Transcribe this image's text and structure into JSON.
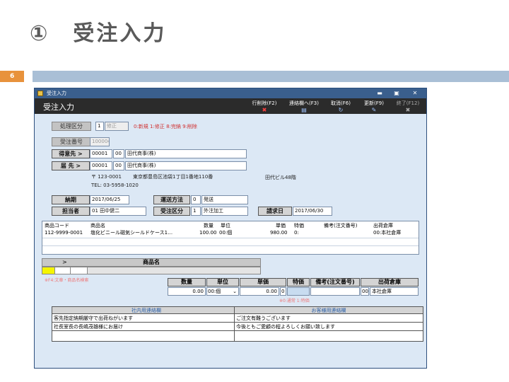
{
  "slide": {
    "title": "①　受注入力",
    "page_number": "6"
  },
  "window": {
    "title": "受注入力",
    "form_title": "受注入力",
    "buttons": {
      "min": "▬",
      "max": "▣",
      "close": "✕"
    }
  },
  "toolbar": [
    {
      "label": "行削除(F2)",
      "icon": "✖",
      "icon_name": "delete-row-icon"
    },
    {
      "label": "連絡欄へ(F3)",
      "icon": "▤",
      "icon_name": "memo-icon"
    },
    {
      "label": "取消(F6)",
      "icon": "↻",
      "icon_name": "undo-icon"
    },
    {
      "label": "更新(F9)",
      "icon": "✎",
      "icon_name": "save-icon"
    },
    {
      "label": "終了(F12)",
      "icon": "✖",
      "icon_name": "exit-icon"
    }
  ],
  "form": {
    "process_label": "処理区分",
    "process_code": "1",
    "process_name": "修正",
    "process_hint": "0:新規 1:修正 8:完納 9:削除",
    "order_no_label": "受注番号",
    "order_no": "100004",
    "customer_label": "得意先 >",
    "customer_code": "00001",
    "customer_sub": "00",
    "customer_name": "田代商事(株)",
    "ship_label": "届 先 >",
    "ship_code": "00001",
    "ship_sub": "00",
    "ship_name": "田代商事(株)",
    "postal": "〒 123-0001",
    "address": "東京都豊島区池袋1丁目1番地110番",
    "building": "田代ビル48階",
    "tel": "TEL: 03-5958-1020",
    "delivery_label": "納期",
    "delivery_date": "2017/06/25",
    "transport_label": "運送方法",
    "transport_code": "0",
    "transport_name": "発送",
    "staff_label": "担当者",
    "staff": "01 田中健二",
    "trade_label": "受注区分",
    "trade_code": "1",
    "trade_name": "外注加工",
    "billing_label": "請求日",
    "billing_date": "2017/06/30"
  },
  "lines": {
    "columns": [
      "商品コード",
      "商品名",
      "数量",
      "単位",
      "単価",
      "特価",
      "備考(注文番号)",
      "出荷倉庫"
    ],
    "rows": [
      [
        "112-9999-0001",
        "塩化ビニール磁気シールドケース1…",
        "100.00",
        "00:個",
        "980.00",
        "0:",
        "",
        "00:本社倉庫"
      ]
    ]
  },
  "product": {
    "arrow": ">",
    "name_header": "商品名",
    "hint": "※F4:文章・商品名検索"
  },
  "detail": {
    "headers": [
      "数量",
      "単位",
      "単価",
      "特価",
      "備考(注文番号)",
      "出荷倉庫"
    ],
    "qty": "0.00",
    "unit": "00:個",
    "price": "0.00",
    "special": "0",
    "remark": "",
    "wh_code": "00",
    "wh_name": "本社倉庫",
    "special_hint": "※0:通常 1:特価"
  },
  "memos": {
    "internal_header": "社内用連絡欄",
    "internal": [
      "客先指定納期厳守で出荷ねがいます",
      "社長室長の長嶋茂雄様にお届け",
      ""
    ],
    "customer_header": "お客様用連絡欄",
    "customer": [
      "ご注文有難うございます",
      "今後ともご愛顧の程よろしくお願い致します",
      ""
    ]
  }
}
